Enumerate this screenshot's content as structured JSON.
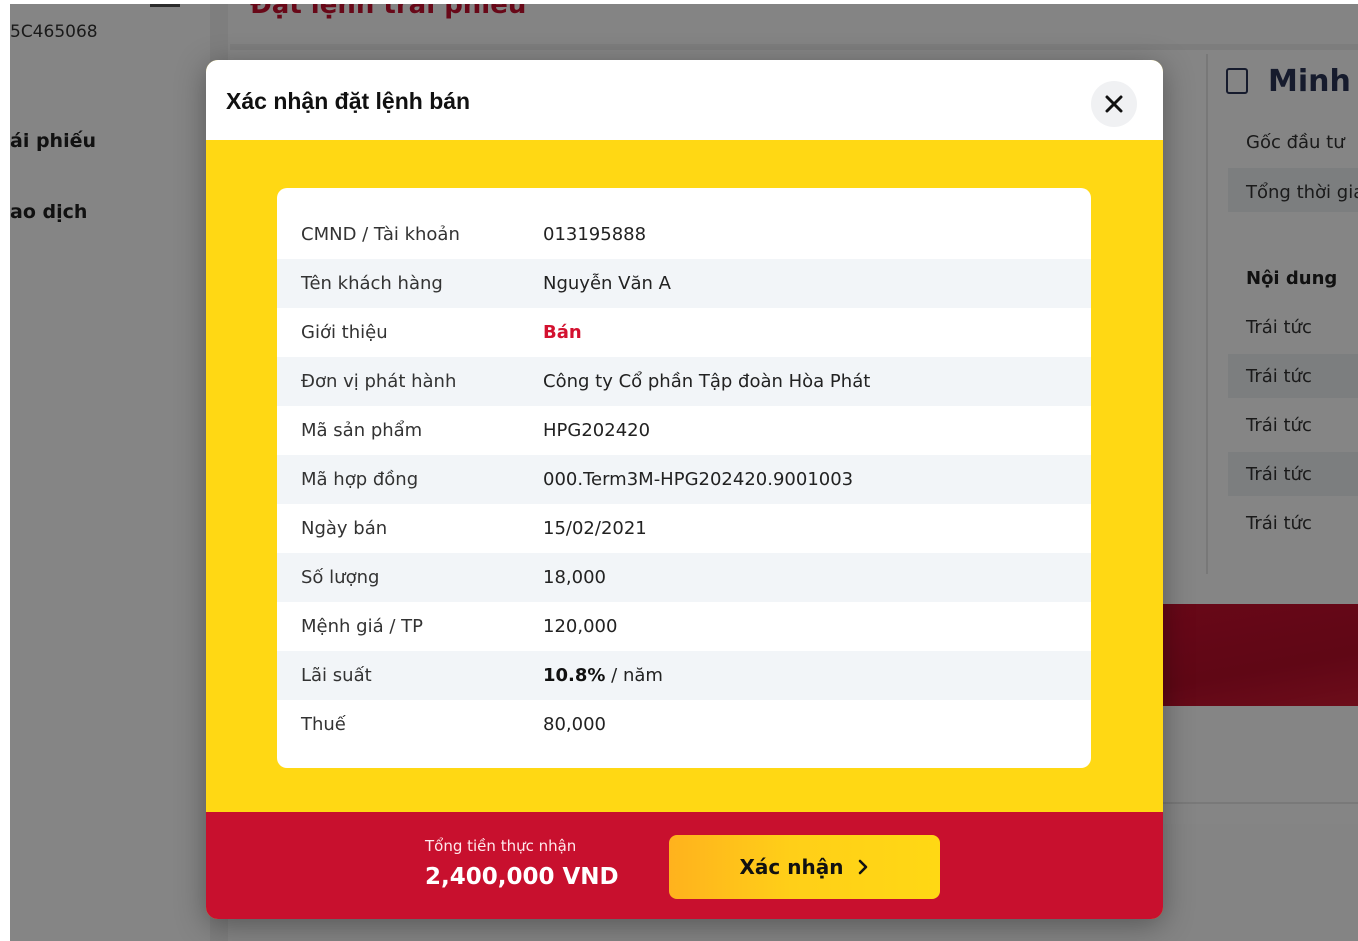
{
  "background": {
    "account_id": "5C465068",
    "nav_items": [
      {
        "label": "ái phiếu"
      },
      {
        "label": "ao dịch"
      }
    ],
    "page_heading": "Đặt lệnh trái phiếu",
    "right_panel": {
      "title": "Minh h",
      "rows": [
        {
          "label": "Gốc đầu tư"
        },
        {
          "label": "Tổng thời gia"
        }
      ],
      "table_header": "Nội dung",
      "table_rows": [
        {
          "label": "Trái tức"
        },
        {
          "label": "Trái tức"
        },
        {
          "label": "Trái tức"
        },
        {
          "label": "Trái tức"
        },
        {
          "label": "Trái tức"
        }
      ]
    }
  },
  "modal": {
    "title": "Xác nhận đặt lệnh bán",
    "close_icon": "close-icon",
    "rows": [
      {
        "label": "CMND / Tài khoản",
        "value": "013195888"
      },
      {
        "label": "Tên khách hàng",
        "value": "Nguyễn Văn A"
      },
      {
        "label": "Giới thiệu",
        "value": "Bán"
      },
      {
        "label": "Đơn vị phát hành",
        "value": "Công ty Cổ phần Tập đoàn Hòa Phát"
      },
      {
        "label": "Mã sản phẩm",
        "value": "HPG202420"
      },
      {
        "label": "Mã hợp đồng",
        "value": "000.Term3M-HPG202420.9001003"
      },
      {
        "label": "Ngày bán",
        "value": "15/02/2021"
      },
      {
        "label": "Số lượng",
        "value": "18,000"
      },
      {
        "label": "Mệnh giá / TP",
        "value": "120,000"
      },
      {
        "label": "Lãi suất",
        "value_bold": "10.8%",
        "value_suffix": " / năm"
      },
      {
        "label": "Thuế",
        "value": "80,000"
      }
    ],
    "footer": {
      "total_label": "Tổng tiền thực nhận",
      "total_value": "2,400,000 VND",
      "confirm_label": "Xác nhận",
      "confirm_icon": "chevron-right-icon"
    }
  },
  "colors": {
    "brand_red": "#c8102e",
    "brand_yellow": "#ffd814",
    "sell_red": "#d3112f"
  }
}
